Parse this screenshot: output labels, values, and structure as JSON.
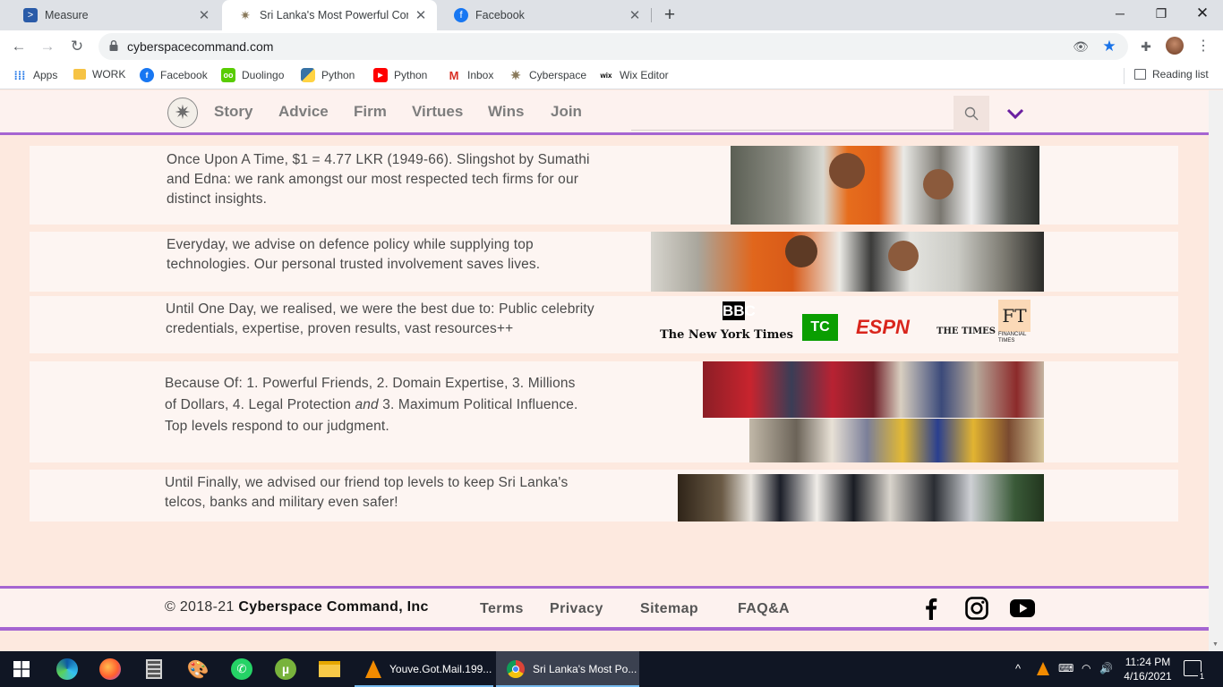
{
  "browser": {
    "tabs": [
      {
        "title": "Measure",
        "active": false
      },
      {
        "title": "Sri Lanka's Most Powerful Corpor",
        "active": true
      },
      {
        "title": "Facebook",
        "active": false
      }
    ],
    "url": "cyberspacecommand.com",
    "bookmarks": [
      {
        "label": "Apps",
        "icon": "apps-grid-icon"
      },
      {
        "label": "WORK",
        "icon": "folder-icon"
      },
      {
        "label": "Facebook",
        "icon": "facebook-icon"
      },
      {
        "label": "Duolingo",
        "icon": "duolingo-icon"
      },
      {
        "label": "Python",
        "icon": "python-icon"
      },
      {
        "label": "Python",
        "icon": "youtube-icon"
      },
      {
        "label": "Inbox",
        "icon": "gmail-icon"
      },
      {
        "label": "Cyberspace",
        "icon": "star-logo-icon"
      },
      {
        "label": "Wix Editor",
        "icon": "wix-icon"
      }
    ],
    "reading_list": "Reading list"
  },
  "site": {
    "nav": [
      "Story",
      "Advice",
      "Firm",
      "Virtues",
      "Wins",
      "Join"
    ],
    "rows": [
      {
        "text": "Once Upon A Time, $1 = 4.77 LKR (1949-66). Slingshot by Sumathi and Edna: we rank amongst our most respected tech firms for our distinct insights."
      },
      {
        "text": "Everyday, we advise on defence policy while supplying top technologies. Our personal trusted involvement saves lives."
      },
      {
        "text": "Until One Day, we realised, we were the best due to: Public celebrity credentials, expertise, proven results, vast resources++"
      },
      {
        "text_before": "Because Of: 1. Powerful Friends, 2. Domain Expertise, 3. Millions of Dollars, 4. Legal Protection ",
        "text_em": "and",
        "text_after": "  3. Maximum Political Influence. Top levels  respond to our judgment."
      },
      {
        "text": "Until Finally, we advised our friend top levels to keep Sri Lanka's telcos, banks and military even safer!"
      }
    ],
    "media_logos": {
      "bbc": "BBC",
      "nyt": "The New York Times",
      "tc": "TC",
      "espn": "ESPN",
      "times": "THE TIMES",
      "ft": "FT",
      "ft_sub": "FINANCIAL TIMES"
    },
    "footer": {
      "copyright_prefix": "© 2018-21 ",
      "company": "Cyberspace Command, Inc",
      "links": [
        "Terms",
        "Privacy",
        "Sitemap",
        "FAQ&A"
      ]
    }
  },
  "taskbar": {
    "apps": [
      {
        "label": "Youve.Got.Mail.199...",
        "icon": "vlc-icon"
      },
      {
        "label": "Sri Lanka's Most Po...",
        "icon": "chrome-icon"
      }
    ],
    "time": "11:24 PM",
    "date": "4/16/2021",
    "notification_count": "1"
  },
  "colors": {
    "accent": "#a565d1",
    "page_bg": "#fde9df",
    "row_bg": "#fdf5f2"
  }
}
